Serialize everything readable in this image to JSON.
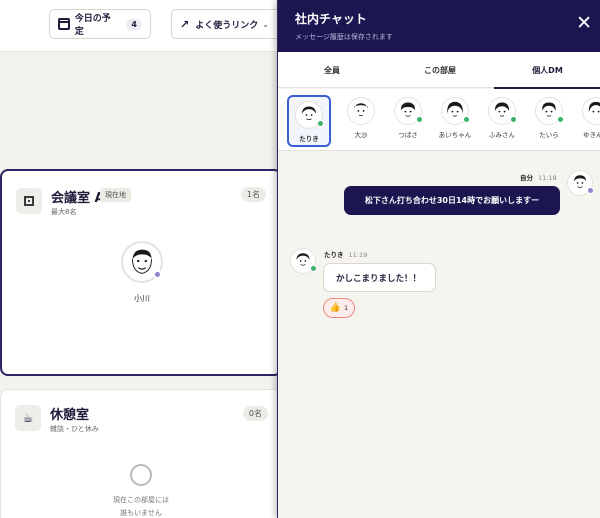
{
  "topbar": {
    "schedule_label": "今日の予定",
    "schedule_count": "4",
    "links_label": "よく使うリンク"
  },
  "rooms": [
    {
      "name": "会議室 A",
      "tag": "現在地",
      "subtitle": "最大8名",
      "count": "1名",
      "members": [
        {
          "name": "小川"
        }
      ]
    },
    {
      "name": "休憩室",
      "subtitle": "雑談・ひと休み",
      "count": "0名",
      "empty_line1": "現在この部屋には",
      "empty_line2": "誰もいません"
    }
  ],
  "chat": {
    "title": "社内チャット",
    "subtitle": "メッセージ履歴は保存されます",
    "close_glyph": "✕",
    "tabs": [
      "全員",
      "この部屋",
      "個人DM"
    ],
    "active_tab": "個人DM",
    "users": [
      {
        "name": "たりき",
        "selected": true,
        "online": true
      },
      {
        "name": "大沙",
        "online": false
      },
      {
        "name": "つばさ",
        "online": true
      },
      {
        "name": "あいちゃん",
        "online": true
      },
      {
        "name": "ふみさん",
        "online": true
      },
      {
        "name": "たいら",
        "online": true
      },
      {
        "name": "ゆきんこ",
        "online": true
      }
    ],
    "messages": [
      {
        "sender": "自分",
        "time": "11:18",
        "text": "松下さん打ち合わせ30日14時でお願いしますー",
        "outgoing": true
      },
      {
        "sender": "たりき",
        "time": "11:19",
        "text": "かしこまりました！！",
        "outgoing": false,
        "reaction": {
          "emoji": "👍",
          "count": "1"
        }
      }
    ]
  },
  "colors": {
    "navy": "#1c1650",
    "online": "#3cb26b",
    "selection": "#3b5fd0",
    "reaction_border": "#e98a7f"
  },
  "icons": [
    "calendar-icon",
    "arrow-up-right-icon",
    "chevron-down-icon",
    "room-icon",
    "coffee-icon",
    "close-icon",
    "thumbs-up-icon"
  ]
}
